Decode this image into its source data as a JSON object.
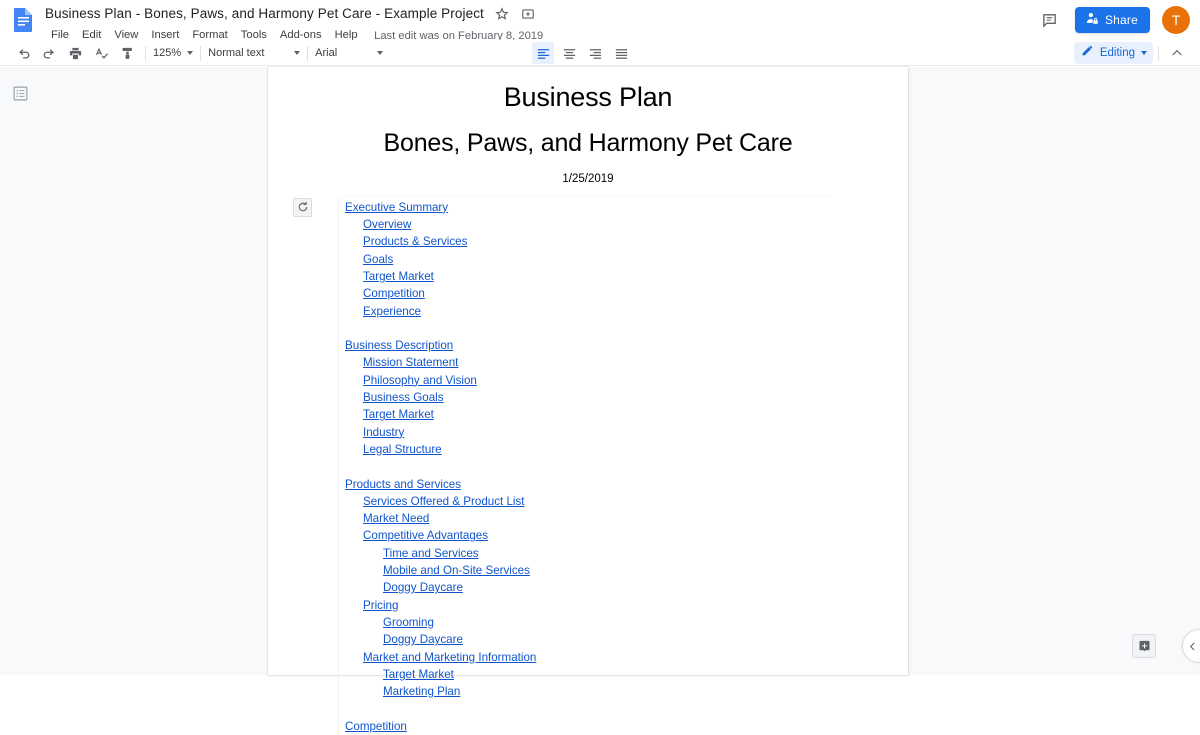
{
  "header": {
    "logo_icon": "google-docs-logo",
    "doc_title": "Business Plan - Bones, Paws, and Harmony Pet Care - Example Project",
    "star_icon": "star-outline-icon",
    "move_folder_icon": "move-to-folder-icon",
    "menu_items": [
      "File",
      "Edit",
      "View",
      "Insert",
      "Format",
      "Tools",
      "Add-ons",
      "Help"
    ],
    "last_edit": "Last edit was on February 8, 2019",
    "comment_icon": "comment-icon",
    "share_label": "Share",
    "share_icon": "share-person-lock-icon",
    "avatar_initial": "T",
    "accent_blue": "#1a73e8",
    "avatar_color": "#e8710a"
  },
  "toolbar": {
    "undo_icon": "undo-icon",
    "redo_icon": "redo-icon",
    "print_icon": "print-icon",
    "spellcheck_icon": "spellcheck-icon",
    "paint_format_icon": "paint-format-icon",
    "zoom_value": "125%",
    "style_value": "Normal text",
    "font_value": "Arial",
    "align_left_icon": "align-left-icon",
    "align_center_icon": "align-center-icon",
    "align_right_icon": "align-right-icon",
    "align_justify_icon": "align-justify-icon",
    "active_alignment": "left",
    "mode_label": "Editing",
    "mode_icon": "pencil-icon",
    "collapse_icon": "chevron-up-icon"
  },
  "canvas": {
    "outline_toggle_icon": "document-outline-icon",
    "explore_icon": "explore-add-icon",
    "side_collapse_icon": "chevron-left-icon",
    "background_color": "#f8f9fa"
  },
  "document": {
    "title": "Business Plan",
    "subtitle": "Bones, Paws, and Harmony Pet Care",
    "date": "1/25/2019",
    "toc_refresh_icon": "refresh-toc-icon",
    "link_color": "#1155cc",
    "toc": [
      {
        "label": "Executive Summary ",
        "level": 1
      },
      {
        "label": "Overview",
        "level": 2
      },
      {
        "label": "Products & Services ",
        "level": 2
      },
      {
        "label": "Goals",
        "level": 2
      },
      {
        "label": "Target Market",
        "level": 2
      },
      {
        "label": "Competition",
        "level": 2
      },
      {
        "label": "Experience",
        "level": 2
      },
      {
        "label": "",
        "level": 0
      },
      {
        "label": "Business Description ",
        "level": 1
      },
      {
        "label": "Mission Statement",
        "level": 2
      },
      {
        "label": "Philosophy and Vision ",
        "level": 2
      },
      {
        "label": "Business Goals",
        "level": 2
      },
      {
        "label": "Target Market",
        "level": 2
      },
      {
        "label": "Industry",
        "level": 2
      },
      {
        "label": "Legal Structure ",
        "level": 2
      },
      {
        "label": "",
        "level": 0
      },
      {
        "label": "Products and Services ",
        "level": 1
      },
      {
        "label": "Services Offered & Product List ",
        "level": 2
      },
      {
        "label": "Market Need",
        "level": 2
      },
      {
        "label": "Competitive Advantages ",
        "level": 2
      },
      {
        "label": "Time and Services",
        "level": 3
      },
      {
        "label": "Mobile and On-Site Services ",
        "level": 3
      },
      {
        "label": "Doggy Daycare ",
        "level": 3
      },
      {
        "label": "Pricing",
        "level": 2
      },
      {
        "label": "Grooming",
        "level": 3
      },
      {
        "label": "Doggy Daycare ",
        "level": 3
      },
      {
        "label": "Market and Marketing Information ",
        "level": 2
      },
      {
        "label": "Target Market",
        "level": 3
      },
      {
        "label": "Marketing Plan",
        "level": 3
      },
      {
        "label": "",
        "level": 0
      },
      {
        "label": "Competition",
        "level": 1
      }
    ]
  }
}
